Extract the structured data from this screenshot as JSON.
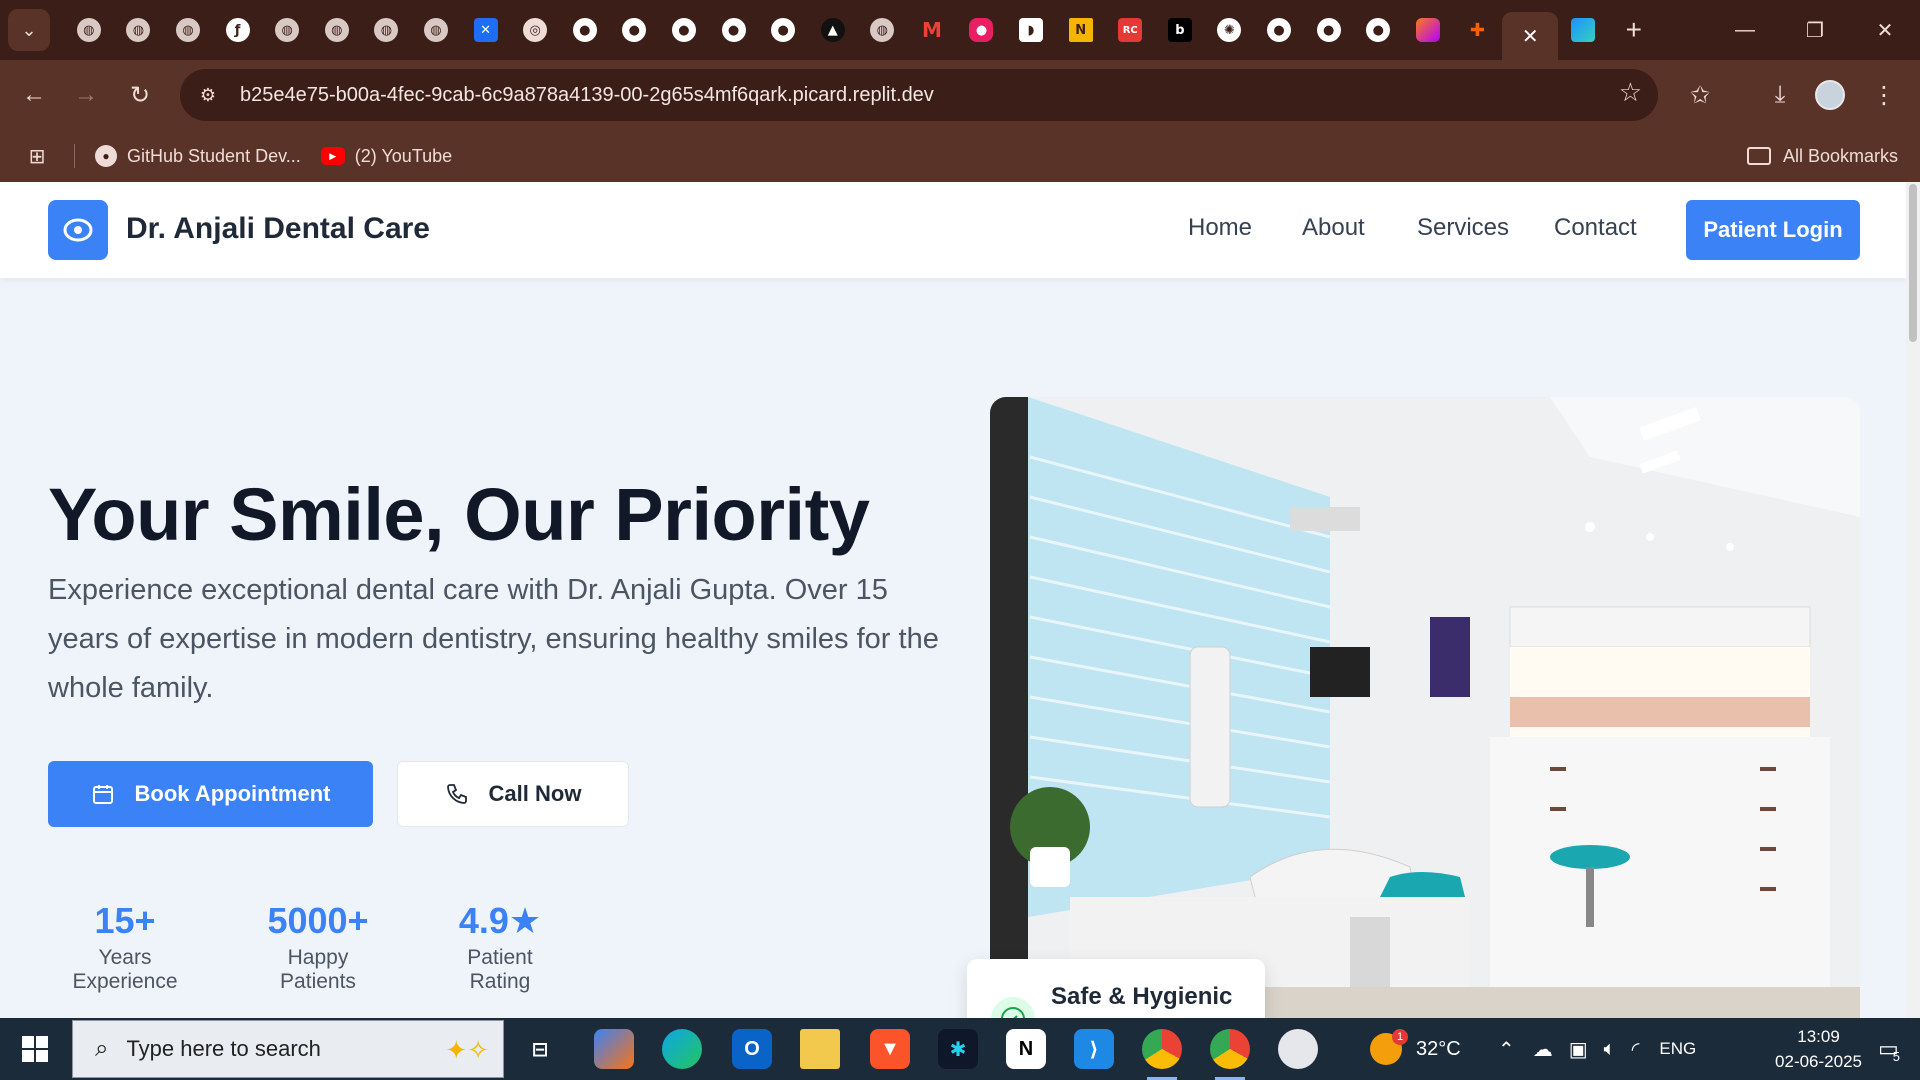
{
  "browser": {
    "url": "b25e4e75-b00a-4fec-9cab-6c9a878a4139-00-2g65s4mf6qark.picard.replit.dev",
    "tab_favicons": [
      "globe-icon",
      "globe-icon",
      "globe-icon",
      "tab-icon",
      "globe-icon",
      "globe-icon",
      "globe-icon",
      "globe-icon",
      "butterfly-icon",
      "chrome-icon",
      "github-icon",
      "github-icon",
      "github-icon",
      "github-icon",
      "github-icon",
      "triangle-icon",
      "globe-icon",
      "gmail-icon",
      "tab-icon",
      "tab-icon",
      "tab-icon",
      "tab-icon",
      "tab-icon",
      "openai-icon",
      "github-icon",
      "github-icon",
      "github-icon",
      "tab-icon",
      "tab-icon",
      "close-icon",
      "replit-icon"
    ],
    "bookmarks": [
      {
        "label": "GitHub Student Dev...",
        "icon": "github-icon"
      },
      {
        "label": "(2) YouTube",
        "icon": "youtube-icon"
      }
    ],
    "all_bookmarks_label": "All Bookmarks"
  },
  "site": {
    "brand": "Dr. Anjali Dental Care",
    "nav": [
      "Home",
      "About",
      "Services",
      "Contact"
    ],
    "login_label": "Patient Login",
    "hero": {
      "title": "Your Smile, Our Priority",
      "description": "Experience exceptional dental care with Dr. Anjali Gupta. Over 15 years of expertise in modern dentistry, ensuring healthy smiles for the whole family.",
      "book_label": "Book Appointment",
      "call_label": "Call Now"
    },
    "stats": [
      {
        "value": "15+",
        "label": "Years Experience"
      },
      {
        "value": "5000+",
        "label": "Happy Patients"
      },
      {
        "value": "4.9★",
        "label": "Patient Rating"
      }
    ],
    "badge_label": "Safe & Hygienic",
    "colors": {
      "accent": "#3b82f6",
      "title": "#111827",
      "body": "#4b5563"
    }
  },
  "taskbar": {
    "search_placeholder": "Type here to search",
    "weather": "32°C",
    "weather_badge": "1",
    "language": "ENG",
    "time": "13:09",
    "date": "02-06-2025",
    "notification_count": "5"
  }
}
